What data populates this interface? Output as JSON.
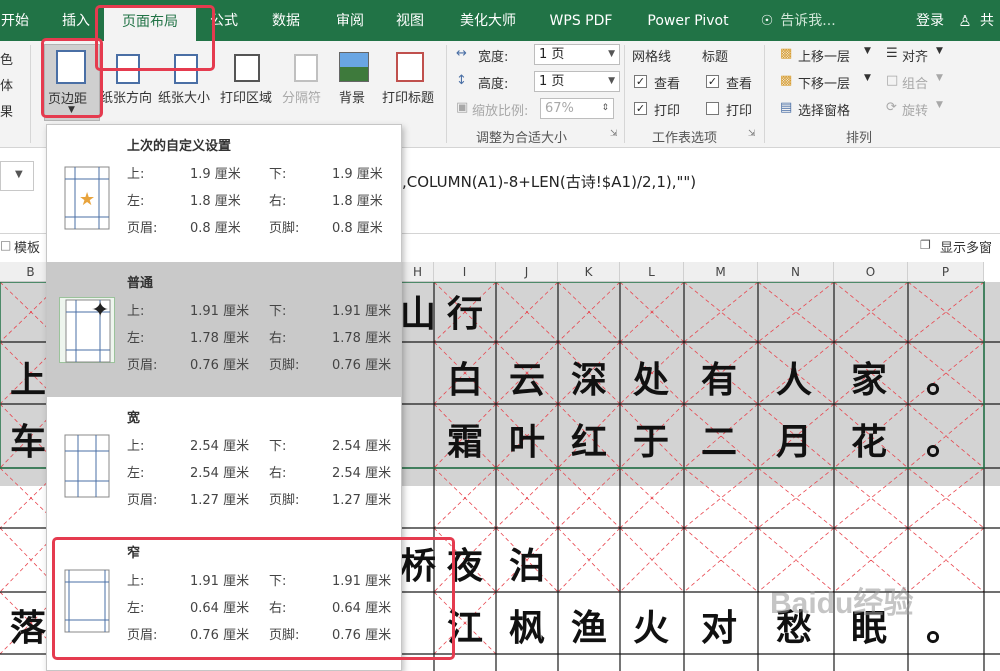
{
  "tabs": {
    "home": "开始",
    "insert": "插入",
    "page_layout": "页面布局",
    "formulas": "公式",
    "data": "数据",
    "review": "审阅",
    "view": "视图",
    "beautify": "美化大师",
    "wps_pdf": "WPS PDF",
    "power_pivot": "Power Pivot",
    "tell_me": "告诉我...",
    "login": "登录",
    "share": "共"
  },
  "ribbon": {
    "left_partial": [
      "色",
      "体",
      "果"
    ],
    "margins": "页边距",
    "orientation": "纸张方向",
    "size": "纸张大小",
    "print_area": "打印区域",
    "breaks": "分隔符",
    "background": "背景",
    "print_titles": "打印标题",
    "width_label": "宽度:",
    "width_value": "1 页",
    "height_label": "高度:",
    "height_value": "1 页",
    "scale_label": "缩放比例:",
    "scale_value": "67%",
    "scale_group": "调整为合适大小",
    "gridlines": "网格线",
    "headings": "标题",
    "view_grid": "查看",
    "view_head": "查看",
    "print_grid": "打印",
    "print_head": "打印",
    "sheet_options_group": "工作表选项",
    "bring_forward": "上移一层",
    "send_backward": "下移一层",
    "selection_pane": "选择窗格",
    "align": "对齐",
    "group": "组合",
    "rotate": "旋转",
    "arrange_group": "排列"
  },
  "formula_bar": {
    "formula": ",COLUMN(A1)-8+LEN(古诗!$A1)/2,1),\"\")"
  },
  "toolbar2": {
    "template": "模板",
    "show_multi": "显示多窗"
  },
  "columns": [
    "B",
    "H",
    "I",
    "J",
    "K",
    "L",
    "M",
    "N",
    "O",
    "P"
  ],
  "sheet_chars": {
    "row1": [
      "山",
      "行"
    ],
    "row2": [
      "上",
      "白",
      "云",
      "深",
      "处",
      "有",
      "人",
      "家",
      "。"
    ],
    "row3": [
      "车",
      "霜",
      "叶",
      "红",
      "于",
      "二",
      "月",
      "花",
      "。"
    ],
    "row4": [
      "桥",
      "夜",
      "泊"
    ],
    "row5": [
      "落",
      "江",
      "枫",
      "渔",
      "火",
      "对",
      "愁",
      "眠",
      "。"
    ]
  },
  "dropdown": {
    "options": [
      {
        "name": "上次的自定义设置",
        "top": "1.9 厘米",
        "bottom": "1.9 厘米",
        "left": "1.8 厘米",
        "right": "1.8 厘米",
        "header": "0.8 厘米",
        "footer": "0.8 厘米"
      },
      {
        "name": "普通",
        "top": "1.91 厘米",
        "bottom": "1.91 厘米",
        "left": "1.78 厘米",
        "right": "1.78 厘米",
        "header": "0.76 厘米",
        "footer": "0.76 厘米"
      },
      {
        "name": "宽",
        "top": "2.54 厘米",
        "bottom": "2.54 厘米",
        "left": "2.54 厘米",
        "right": "2.54 厘米",
        "header": "1.27 厘米",
        "footer": "1.27 厘米"
      },
      {
        "name": "窄",
        "top": "1.91 厘米",
        "bottom": "1.91 厘米",
        "left": "0.64 厘米",
        "right": "0.64 厘米",
        "header": "0.76 厘米",
        "footer": "0.76 厘米"
      }
    ],
    "labels": {
      "top": "上:",
      "bottom": "下:",
      "left": "左:",
      "right": "右:",
      "header": "页眉:",
      "footer": "页脚:"
    }
  },
  "watermark": "Baidu经验",
  "colors": {
    "excel_green": "#217346",
    "highlight_red": "#e53b4f",
    "selected_gray": "#c9c9c9"
  }
}
